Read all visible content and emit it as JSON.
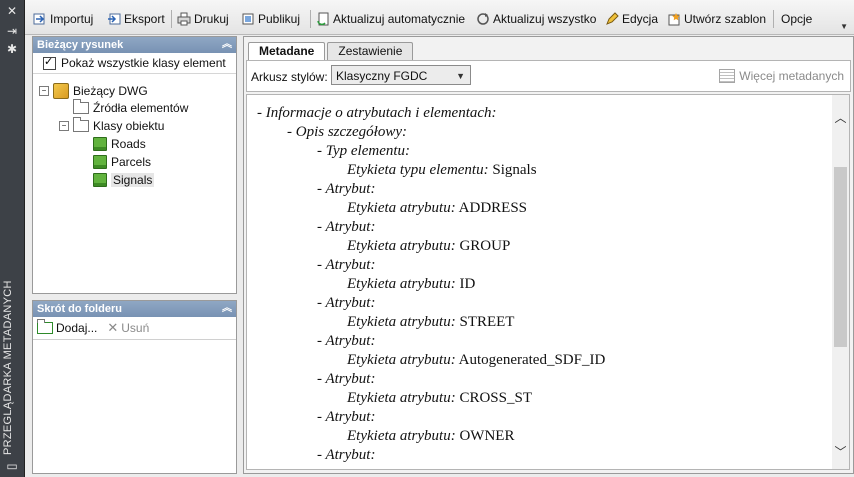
{
  "palette": {
    "title_bar": "#3d4147",
    "panel_header": "#8fa7c4",
    "background": "#ececec"
  },
  "sidebar": {
    "title": "PRZEGLĄDARKA METADANYCH",
    "buttons": [
      "close-icon",
      "pin-icon",
      "gear-icon",
      "menu-icon"
    ]
  },
  "toolbar": {
    "import_label": "Importuj",
    "export_label": "Eksport",
    "print_label": "Drukuj",
    "publish_label": "Publikuj",
    "auto_update_label": "Aktualizuj automatycznie",
    "update_all_label": "Aktualizuj wszystko",
    "edit_label": "Edycja",
    "create_template_label": "Utwórz szablon",
    "options_label": "Opcje"
  },
  "current_drawing": {
    "header": "Bieżący rysunek",
    "show_all_label": "Pokaż wszystkie klasy element",
    "tree": {
      "root": "Bieżący DWG",
      "sources": "Źródła elementów",
      "classes": "Klasy obiektu",
      "items": [
        "Roads",
        "Parcels",
        "Signals"
      ]
    }
  },
  "folder_shortcut": {
    "header": "Skrót do folderu",
    "add_label": "Dodaj...",
    "remove_label": "Usuń"
  },
  "viewer": {
    "tabs": [
      "Metadane",
      "Zestawienie"
    ],
    "stylesheet_label": "Arkusz stylów:",
    "stylesheet_value": "Klasyczny FGDC",
    "more_metadata_label": "Więcej metadanych"
  },
  "document": {
    "attr_info": "- Informacje o atrybutach i elementach:",
    "detail_desc": "- Opis szczegółowy:",
    "entity_type": "- Typ elementu:",
    "entity_label_key": "Etykieta typu elementu:",
    "entity_label_value": "Signals",
    "attribute_heading": "- Atrybut:",
    "attribute_label_key": "Etykieta atrybutu:",
    "attributes": [
      "ADDRESS",
      "GROUP",
      "ID",
      "STREET",
      "Autogenerated_SDF_ID",
      "CROSS_ST",
      "OWNER"
    ]
  }
}
